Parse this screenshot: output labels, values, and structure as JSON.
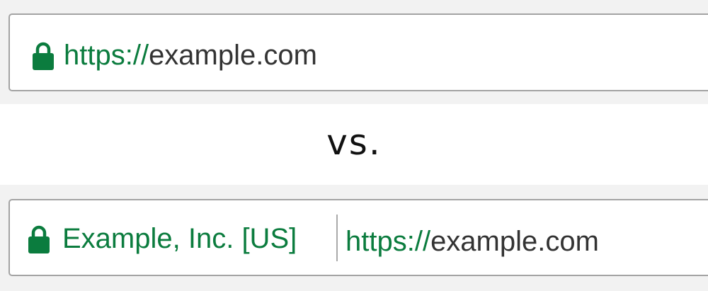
{
  "colors": {
    "secure_green": "#0b7c3e",
    "host_text": "#333333",
    "bar_border": "#a3a3a3",
    "band_background": "#f2f2f2"
  },
  "top_bar": {
    "icon": "lock-icon",
    "scheme": "https://",
    "host": "example.com"
  },
  "separator": {
    "text": "vs."
  },
  "bottom_bar": {
    "icon": "lock-icon",
    "ev_name": "Example, Inc. [US]",
    "scheme": "https://",
    "host": "example.com"
  }
}
